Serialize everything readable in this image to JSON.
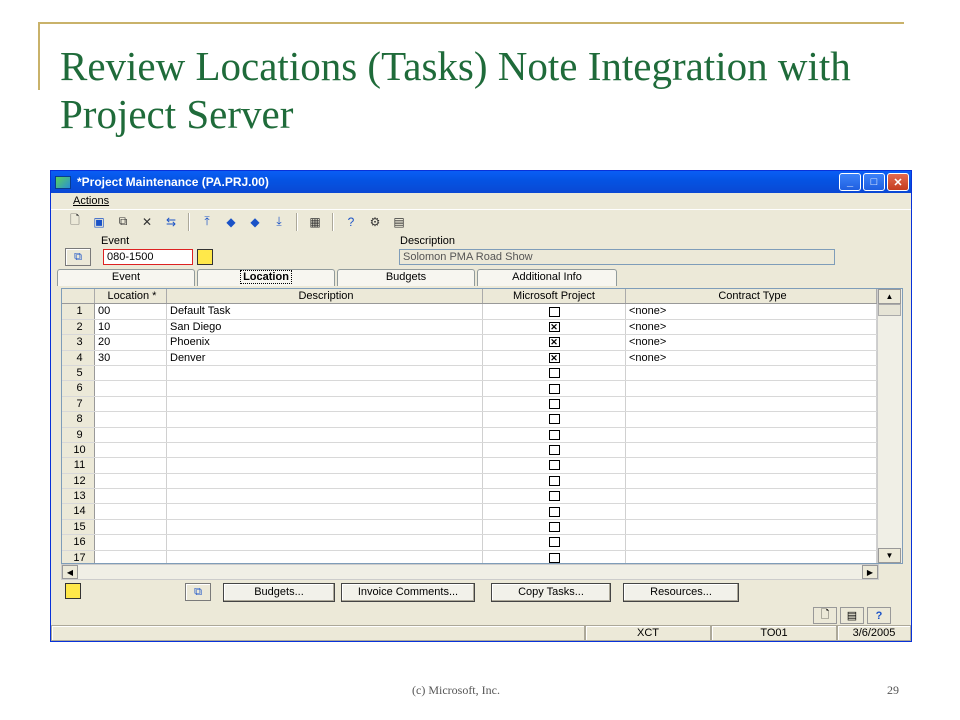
{
  "slide": {
    "title": "Review Locations (Tasks) Note Integration with Project Server",
    "footer_left": "(c) Microsoft, Inc.",
    "footer_right": "29"
  },
  "window": {
    "title": "*Project Maintenance (PA.PRJ.00)",
    "menu": "Actions"
  },
  "form": {
    "event_label": "Event",
    "event_value": "080-1500",
    "description_label": "Description",
    "description_value": "Solomon PMA Road Show"
  },
  "tabs": [
    "Event",
    "Location",
    "Budgets",
    "Additional Info"
  ],
  "grid": {
    "columns": [
      "Location *",
      "Description",
      "Microsoft Project",
      "Contract Type"
    ],
    "rows": [
      {
        "num": "1",
        "location": "00",
        "description": "Default Task",
        "ms_project": false,
        "contract_type": "<none>"
      },
      {
        "num": "2",
        "location": "10",
        "description": "San Diego",
        "ms_project": true,
        "contract_type": "<none>"
      },
      {
        "num": "3",
        "location": "20",
        "description": "Phoenix",
        "ms_project": true,
        "contract_type": "<none>"
      },
      {
        "num": "4",
        "location": "30",
        "description": "Denver",
        "ms_project": true,
        "contract_type": "<none>"
      },
      {
        "num": "5",
        "location": "",
        "description": "",
        "ms_project": false,
        "contract_type": ""
      },
      {
        "num": "6",
        "location": "",
        "description": "",
        "ms_project": false,
        "contract_type": ""
      },
      {
        "num": "7",
        "location": "",
        "description": "",
        "ms_project": false,
        "contract_type": ""
      },
      {
        "num": "8",
        "location": "",
        "description": "",
        "ms_project": false,
        "contract_type": ""
      },
      {
        "num": "9",
        "location": "",
        "description": "",
        "ms_project": false,
        "contract_type": ""
      },
      {
        "num": "10",
        "location": "",
        "description": "",
        "ms_project": false,
        "contract_type": ""
      },
      {
        "num": "11",
        "location": "",
        "description": "",
        "ms_project": false,
        "contract_type": ""
      },
      {
        "num": "12",
        "location": "",
        "description": "",
        "ms_project": false,
        "contract_type": ""
      },
      {
        "num": "13",
        "location": "",
        "description": "",
        "ms_project": false,
        "contract_type": ""
      },
      {
        "num": "14",
        "location": "",
        "description": "",
        "ms_project": false,
        "contract_type": ""
      },
      {
        "num": "15",
        "location": "",
        "description": "",
        "ms_project": false,
        "contract_type": ""
      },
      {
        "num": "16",
        "location": "",
        "description": "",
        "ms_project": false,
        "contract_type": ""
      },
      {
        "num": "17",
        "location": "",
        "description": "",
        "ms_project": false,
        "contract_type": ""
      }
    ]
  },
  "buttons": {
    "budgets": "Budgets...",
    "invoice_comments": "Invoice Comments...",
    "copy_tasks": "Copy Tasks...",
    "resources": "Resources..."
  },
  "status": {
    "company": "XCT",
    "user": "TO01",
    "date": "3/6/2005"
  },
  "colors": {
    "title_green": "#1f6b3a",
    "titlebar_blue": "#0554e3"
  }
}
